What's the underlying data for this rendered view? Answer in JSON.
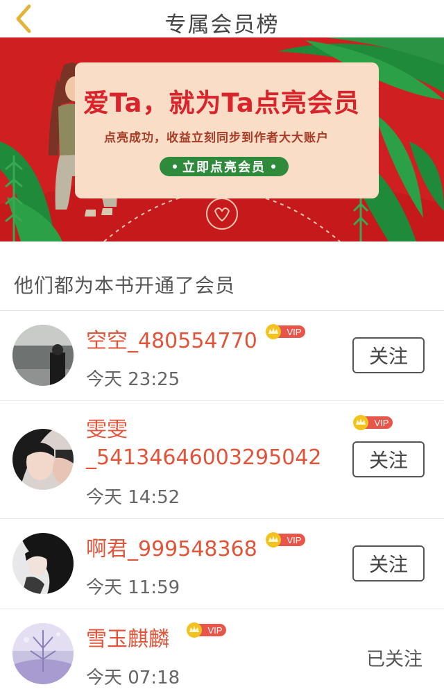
{
  "header": {
    "title": "专属会员榜"
  },
  "banner": {
    "headline": "爱Ta，就为Ta点亮会员",
    "subtext": "点亮成功，收益立刻同步到作者大大账户",
    "cta_label": "立即点亮会员",
    "colors": {
      "background": "#cf1f21",
      "card": "#f9ddc7",
      "button": "#2f8a3b"
    }
  },
  "section": {
    "title": "他们都为本书开通了会员"
  },
  "vip_label": "VIP",
  "members": [
    {
      "name": "空空_480554770",
      "time": "今天 23:25",
      "action": "关注",
      "followed": false
    },
    {
      "name_line1": "雯雯",
      "name_line2": "_54134646003295042",
      "time": "今天 14:52",
      "action": "关注",
      "followed": false
    },
    {
      "name": "啊君_999548368",
      "time": "今天 11:59",
      "action": "关注",
      "followed": false
    },
    {
      "name": "雪玉麒麟",
      "time": "今天 07:18",
      "action": "已关注",
      "followed": true
    }
  ],
  "colors": {
    "username": "#e2543a",
    "vip_badge": "#e8554a",
    "crown": "#f2c21f"
  }
}
